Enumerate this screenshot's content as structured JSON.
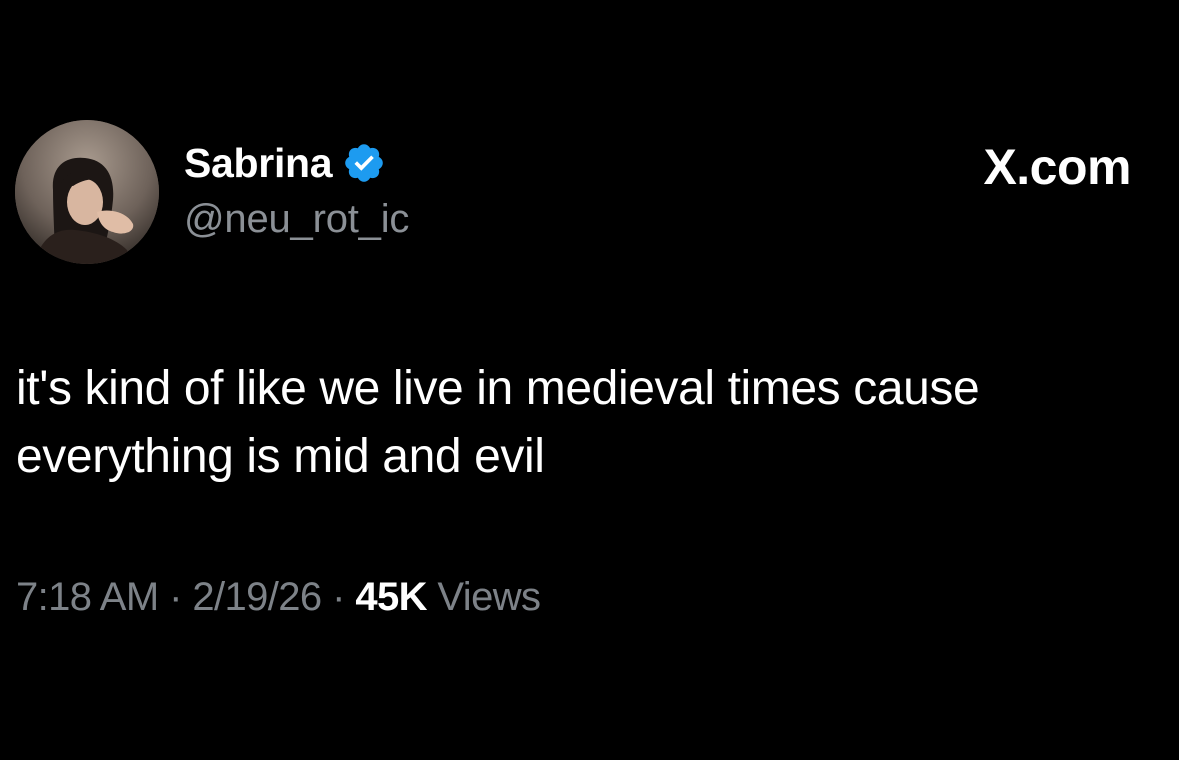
{
  "author": {
    "display_name": "Sabrina",
    "handle": "@neu_rot_ic",
    "verified": true,
    "verified_color": "#1d9bf0"
  },
  "brand": "X.com",
  "tweet": {
    "text": "it's kind of like we live in medieval times cause\neverything is mid and evil"
  },
  "meta": {
    "time": "7:18 AM",
    "separator_1": " · ",
    "date": "2/19/26",
    "separator_2": " · ",
    "views_count": "45K",
    "views_label": " Views"
  },
  "colors": {
    "background": "#000000",
    "primary_text": "#ffffff",
    "secondary_text": "#8b9096"
  }
}
